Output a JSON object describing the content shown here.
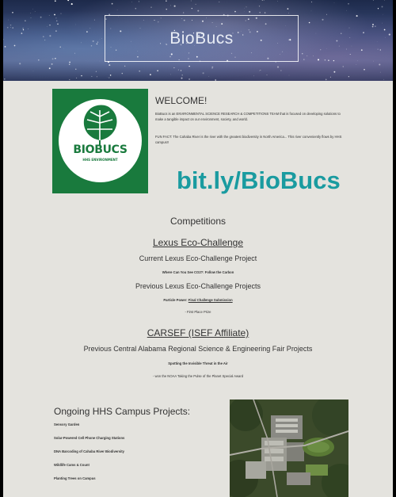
{
  "banner": {
    "title": "BioBucs"
  },
  "logo": {
    "wordmark": "BIOBUCS",
    "tagline": "HHS ENVIRONMENT"
  },
  "welcome": {
    "heading": "WELCOME!",
    "paragraph1": "BioBucs is an ENVIRONMENTAL SCIENCE RESEARCH & COMPETITIONS TEAM that is focused on developing solutions to make a tangible impact on our environment, society, and world.",
    "paragraph2": "FUN FACT: The Cahaba River is the river with the greatest biodiversity in North America... This river conveniently flows by HHS campus!!"
  },
  "link": {
    "text": "bit.ly/BioBucs"
  },
  "competitions": {
    "heading": "Competitions",
    "lexus": {
      "heading": "Lexus Eco-Challenge",
      "current_label": "Current Lexus Eco-Challenge Project",
      "current_item": "Where Can You See CO2?: Follow the Carbon",
      "previous_label": "Previous Lexus Eco-Challenge Projects",
      "previous_item_prefix": "Particle Power:",
      "previous_item_link": "Final Challenge Submission",
      "previous_award": "- First Place Prize"
    },
    "carsef": {
      "heading": "CARSEF (ISEF Affiliate)",
      "label": "Previous Central Alabama Regional Science & Engineering Fair Projects",
      "item1": "Spotting the Invisible Threat in the Air",
      "item2": "- won the NOAA Taking the Pulse of the Planet Special Award"
    }
  },
  "ongoing": {
    "heading": "Ongoing HHS Campus Projects:",
    "projects": [
      "Sensory Garden",
      "Solar-Powered Cell Phone Charging Stations",
      "DNA Barcoding of Cahaba River Biodiversity",
      "Wildlife Cams & Count",
      "Planting Trees on Campus"
    ]
  },
  "colors": {
    "page_background": "#e4e3de",
    "logo_green": "#197a3d",
    "link_teal": "#1a9ba0",
    "text": "#333333"
  }
}
